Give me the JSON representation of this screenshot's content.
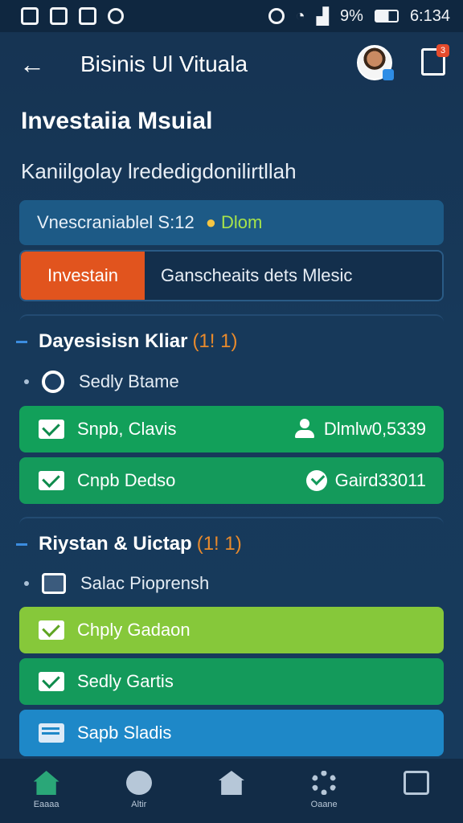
{
  "status_bar": {
    "battery_text": "9%",
    "time": "6:134",
    "left_icons": [
      "sim-icon",
      "image-icon",
      "document-icon",
      "sync-icon"
    ],
    "right_icons": [
      "alarm-icon",
      "wifi-icon",
      "signal-icon",
      "battery-icon"
    ]
  },
  "app_bar": {
    "title": "Bisinis Ul Vituala",
    "back_icon": "arrow-left-icon",
    "badge_count": "3"
  },
  "page": {
    "heading": "Investaiia Msuial",
    "subheading": "Kaniilgolay lrededigdonilirtllah"
  },
  "info_bar": {
    "text": "Vnescraniablel S:12",
    "accent_text": "Dlom",
    "icon": "lightbulb-icon"
  },
  "input_row": {
    "button_label": "Investain",
    "field_text": "Ganscheaits dets Mlesic"
  },
  "section1": {
    "title": "Dayesisisn Kliar",
    "count": "(1! 1)",
    "sub_item": "Sedly Btame",
    "cards": [
      {
        "label": "Snpb, Clavis",
        "right_text": "Dlmlw0,5339",
        "right_icon": "person-icon"
      },
      {
        "label": "Cnpb Dedso",
        "right_text": "Gaird33011",
        "right_icon": "check-circle-icon"
      }
    ]
  },
  "section2": {
    "title": "Riystan & Uictap",
    "count": "(1! 1)",
    "sub_item": "Salac Pioprensh",
    "cards": [
      {
        "label": "Chply Gadaon"
      },
      {
        "label": "Sedly Gartis"
      },
      {
        "label": "Sapb Sladis"
      }
    ]
  },
  "bottom_nav": [
    {
      "label": "Eaaaa",
      "icon": "home-icon"
    },
    {
      "label": "Altir",
      "icon": "chat-icon"
    },
    {
      "label": "",
      "icon": "house-icon"
    },
    {
      "label": "Oaane",
      "icon": "settings-icon"
    },
    {
      "label": "",
      "icon": "message-icon"
    }
  ],
  "colors": {
    "background": "#163352",
    "accent_orange": "#e1541e",
    "green": "#12a05a",
    "lime": "#86c83a",
    "blue": "#1e88c8"
  }
}
